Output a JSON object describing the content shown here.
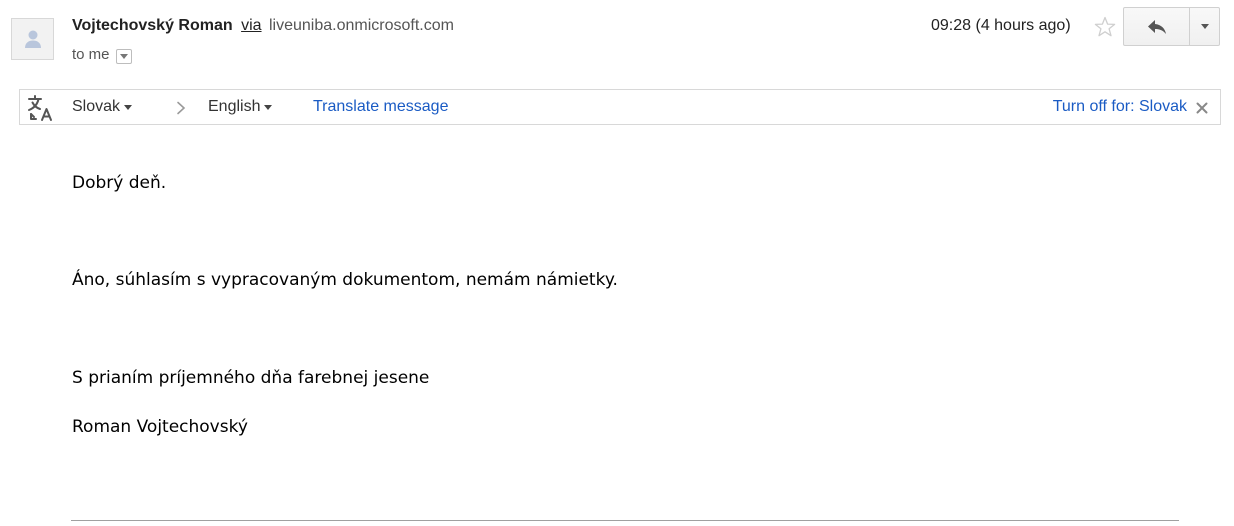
{
  "header": {
    "sender_name": "Vojtechovský Roman",
    "via_label": "via",
    "sender_domain": "liveuniba.onmicrosoft.com",
    "recipient_label": "to me",
    "timestamp": "09:28 (4 hours ago)"
  },
  "translate_bar": {
    "source_language": "Slovak",
    "target_language": "English",
    "translate_link": "Translate message",
    "turn_off_link": "Turn off for: Slovak"
  },
  "message": {
    "greeting": "Dobrý deň.",
    "body": "Áno, súhlasím s vypracovaným dokumentom, nemám námietky.",
    "closing": "S prianím príjemného dňa farebnej jesene",
    "signature": "Roman Vojtechovský"
  },
  "icons": {
    "avatar": "person-icon",
    "star": "star-icon",
    "reply": "reply-icon",
    "more": "chevron-down-icon",
    "translate": "translate-icon",
    "close": "close-icon"
  },
  "colors": {
    "link": "#1a5bc4",
    "text": "#222222",
    "muted": "#555555",
    "border": "#d8d8d8"
  }
}
